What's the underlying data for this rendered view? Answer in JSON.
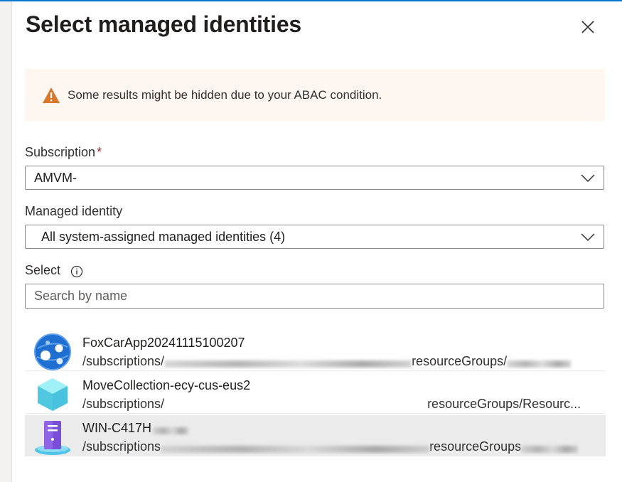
{
  "dialog": {
    "title": "Select managed identities",
    "close_icon": "close-icon"
  },
  "warning": {
    "icon": "warning-icon",
    "text": "Some results might be hidden due to your ABAC condition.",
    "color": "#d8762b"
  },
  "subscription": {
    "label": "Subscription",
    "required_mark": "*",
    "value": "AMVM-"
  },
  "managed_identity": {
    "label": "Managed identity",
    "value": "All system-assigned managed identities (4)"
  },
  "select": {
    "label": "Select",
    "search_placeholder": "Search by name"
  },
  "results": [
    {
      "name": "FoxCarApp20241115100207",
      "path_prefix": "/subscriptions/",
      "path_suffix": "resourceGroups/",
      "icon": "app-service-globe-icon",
      "selected": false
    },
    {
      "name": "MoveCollection-ecy-cus-eus2",
      "path_prefix": "/subscriptions/",
      "path_suffix": "resourceGroups/Resourc...",
      "icon": "resource-mover-cube-icon",
      "selected": false
    },
    {
      "name": "WIN-C417H",
      "path_prefix": "/subscriptions",
      "path_suffix": "resourceGroups",
      "icon": "virtual-machine-server-icon",
      "selected": true
    }
  ]
}
